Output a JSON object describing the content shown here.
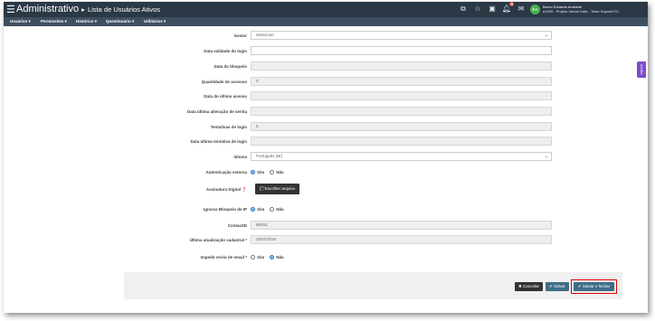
{
  "app": {
    "title": "Administrativo",
    "breadcrumb_sep": "▸",
    "page_title": "Lista de Usuários Ativos"
  },
  "header": {
    "icons": [
      "sitemap-icon",
      "star-icon",
      "calendar-icon",
      "bell-icon",
      "envelope-icon"
    ],
    "bell_badge": "8",
    "user_initials": "EA",
    "user_name": "Bruno Eduardo Andrade",
    "user_company": "#1299 - Projeto Venda Gate - Teste Suporte/TC"
  },
  "menu": [
    "Usuários ▾",
    "Permissões ▾",
    "Histórico ▾",
    "Questionário ▾",
    "Utilitários ▾"
  ],
  "side_tab": "AJUDA",
  "form": {
    "gestor": {
      "label": "Gestor",
      "value": "Selecione"
    },
    "data_validade": {
      "label": "Data validade do login",
      "value": ""
    },
    "data_bloqueio": {
      "label": "Data do bloqueio",
      "value": ""
    },
    "qtd_acessos": {
      "label": "Quantidade de acessos",
      "value": "0"
    },
    "data_ultimo_acesso": {
      "label": "Data do último acesso",
      "value": ""
    },
    "data_alteracao_senha": {
      "label": "Data última alteração de senha",
      "value": ""
    },
    "tentativas_login": {
      "label": "Tentativas de login",
      "value": "0"
    },
    "data_ultima_tentativa": {
      "label": "Data última tentativa de login",
      "value": ""
    },
    "idioma": {
      "label": "Idioma",
      "value": "Português (Br)"
    },
    "autenticacao_externa": {
      "label": "Autenticação externa",
      "opt_yes": "Sim",
      "opt_no": "Não",
      "selected": "Sim"
    },
    "assinatura_digital": {
      "label": "Assinatura Digital",
      "help": "❓",
      "button": "Escolher arquivo"
    },
    "ignorar_bloqueio_ip": {
      "label": "Ignorar Bloqueio de IP",
      "opt_yes": "Sim",
      "opt_no": "Não",
      "selected": "Sim"
    },
    "contact_id": {
      "label": "ContactID",
      "value": "99253"
    },
    "ultima_atualizacao": {
      "label": "Última atualização cadastral",
      "required": "*",
      "value": "22/07/2024"
    },
    "impedir_envio_email": {
      "label": "Impedir envio de email",
      "required": "*",
      "opt_yes": "Sim",
      "opt_no": "Não",
      "selected": "Não"
    }
  },
  "footer": {
    "cancel": "✖ Cancelar",
    "save": "✔ Salvar",
    "save_close": "✔ Salvar e fechar"
  }
}
